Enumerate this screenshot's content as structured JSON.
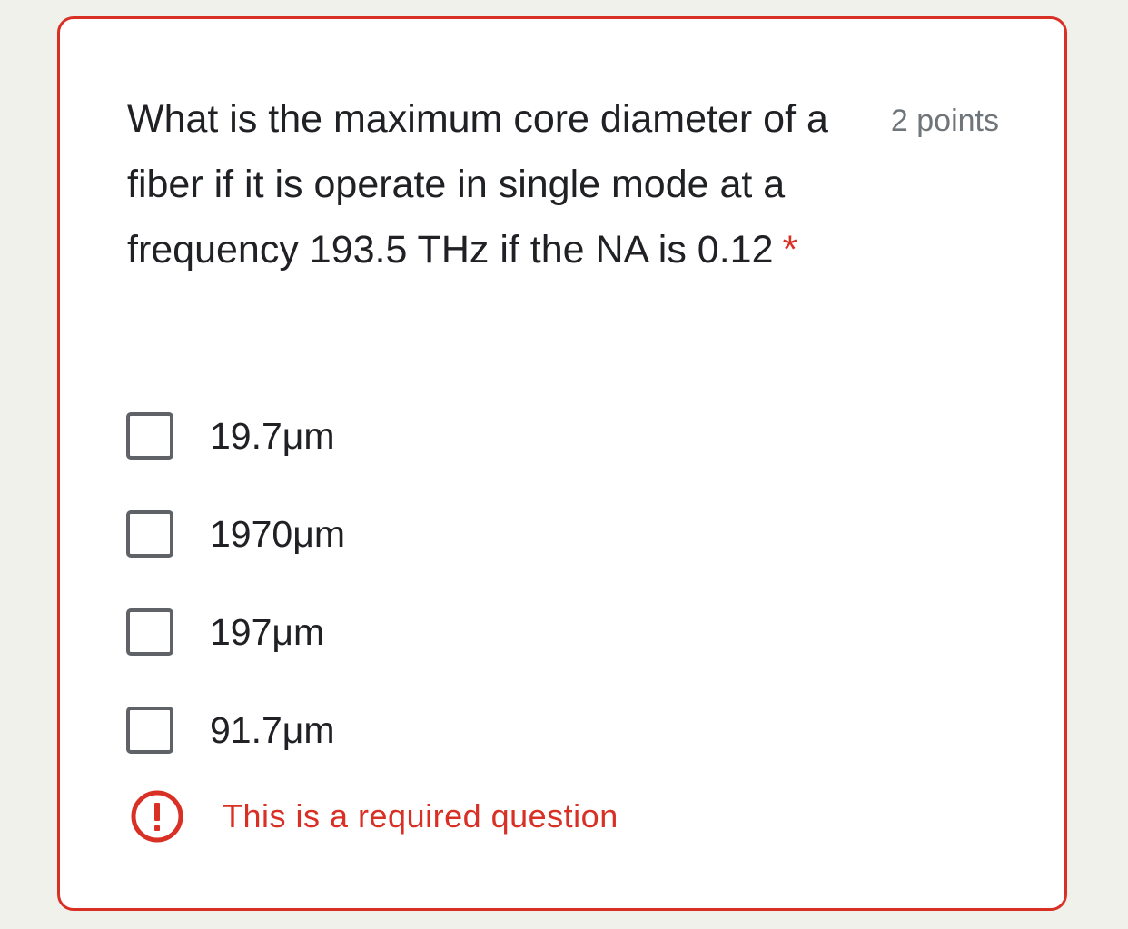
{
  "question": {
    "text": "What is the maximum core diameter of a fiber if it is operate in single mode at a frequency 193.5 THz if the NA is 0.12",
    "required_marker": "*",
    "points": "2 points"
  },
  "options": [
    {
      "label": "19.7μm",
      "checked": false
    },
    {
      "label": "1970μm",
      "checked": false
    },
    {
      "label": "197μm",
      "checked": false
    },
    {
      "label": "91.7μm",
      "checked": false
    }
  ],
  "error": {
    "icon": "error-exclamation-icon",
    "message": "This is a required question"
  },
  "colors": {
    "error": "#d93025",
    "text": "#202124",
    "muted": "#70757a",
    "checkbox_border": "#5f6368",
    "page_background": "#f1f1ec"
  }
}
